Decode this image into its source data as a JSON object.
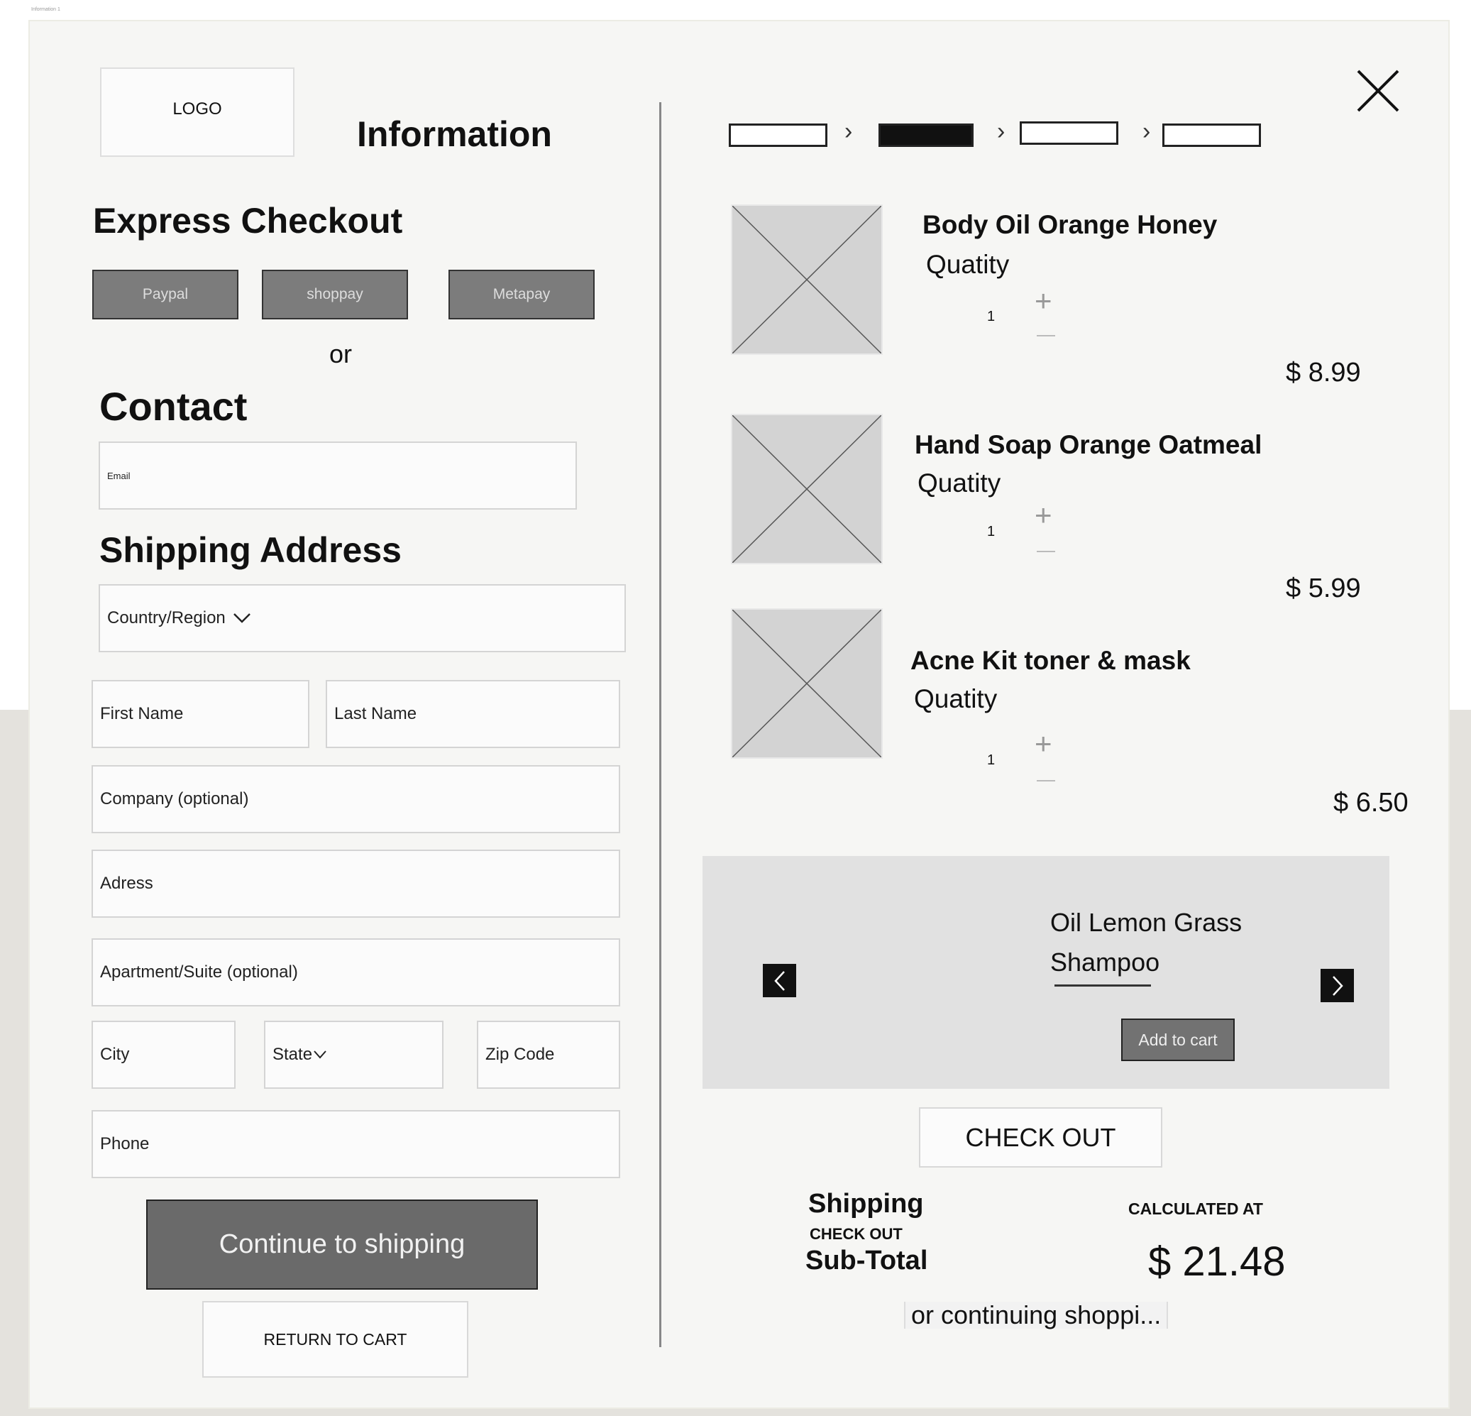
{
  "page": {
    "frame_label": "Information 1",
    "logo": "LOGO",
    "title": "Information",
    "close_icon": "close-icon"
  },
  "express": {
    "heading": "Express Checkout",
    "buttons": [
      "Paypal",
      "shoppay",
      "Metapay"
    ],
    "or": "or"
  },
  "contact": {
    "heading": "Contact",
    "email_label": "Email"
  },
  "shipping_address": {
    "heading": "Shipping Address",
    "country": "Country/Region",
    "first_name": "First Name",
    "last_name": "Last Name",
    "company": "Company (optional)",
    "address": "Adress",
    "apartment": "Apartment/Suite (optional)",
    "city": "City",
    "state": "State",
    "zip": "Zip Code",
    "phone": "Phone"
  },
  "actions": {
    "continue": "Continue to shipping",
    "return": "RETURN TO CART"
  },
  "progress": {
    "steps": 4,
    "active_step": 2
  },
  "cart": {
    "quantity_label": "Quatity",
    "items": [
      {
        "name": "Body Oil Orange Honey",
        "quantity": "1",
        "price": "$ 8.99"
      },
      {
        "name": "Hand Soap Orange Oatmeal",
        "quantity": "1",
        "price": "$ 5.99"
      },
      {
        "name": "Acne Kit toner & mask",
        "quantity": "1",
        "price": "$ 6.50"
      }
    ]
  },
  "upsell": {
    "name_line1": "Oil Lemon Grass",
    "name_line2": "Shampoo",
    "add_to_cart": "Add to cart",
    "prev_icon": "chevron-left-icon",
    "next_icon": "chevron-right-icon"
  },
  "summary": {
    "checkout": "CHECK OUT",
    "shipping_label": "Shipping",
    "checkout_small": "CHECK OUT",
    "subtotal_label": "Sub-Total",
    "calculated_at": "CALCULATED AT",
    "total": "$ 21.48",
    "continue_shopping": "or continuing shoppi..."
  },
  "colors": {
    "button_gray": "#7c7c7c",
    "primary_gray": "#6a6a6a",
    "panel_gray": "#e1e1e1",
    "placeholder_gray": "#d3d3d3"
  }
}
